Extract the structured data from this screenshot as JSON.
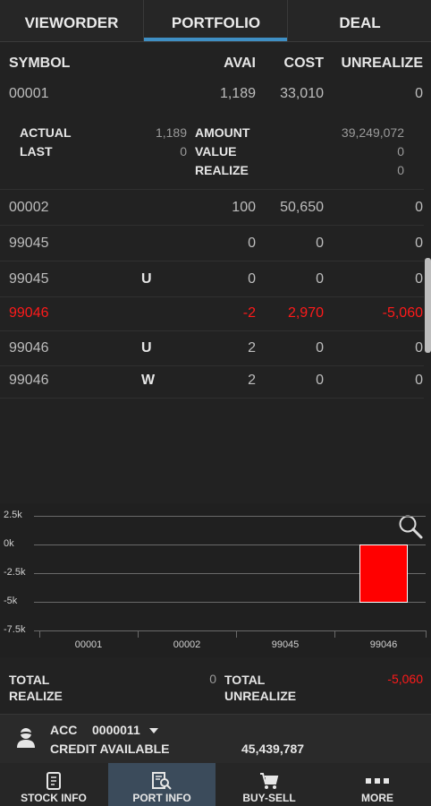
{
  "tabs": [
    {
      "label": "VIEWORDER"
    },
    {
      "label": "PORTFOLIO"
    },
    {
      "label": "DEAL"
    }
  ],
  "table": {
    "headers": {
      "symbol": "SYMBOL",
      "avai": "AVAI",
      "cost": "COST",
      "unrealize": "UNREALIZE"
    },
    "first_row": {
      "symbol": "00001",
      "flag": "",
      "avai": "1,189",
      "cost": "33,010",
      "unrealize": "0"
    },
    "detail": {
      "actual_label": "ACTUAL",
      "actual_value": "1,189",
      "last_label": "LAST",
      "last_value": "0",
      "amount_label": "AMOUNT",
      "amount_value": "39,249,072",
      "value_label": "VALUE",
      "value_value": "0",
      "realize_label": "REALIZE",
      "realize_value": "0"
    },
    "rows": [
      {
        "symbol": "00002",
        "flag": "",
        "avai": "100",
        "cost": "50,650",
        "unrealize": "0"
      },
      {
        "symbol": "99045",
        "flag": "",
        "avai": "0",
        "cost": "0",
        "unrealize": "0"
      },
      {
        "symbol": "99045",
        "flag": "U",
        "avai": "0",
        "cost": "0",
        "unrealize": "0"
      },
      {
        "symbol": "99046",
        "flag": "",
        "avai": "-2",
        "cost": "2,970",
        "unrealize": "-5,060"
      },
      {
        "symbol": "99046",
        "flag": "U",
        "avai": "2",
        "cost": "0",
        "unrealize": "0"
      },
      {
        "symbol": "99046",
        "flag": "W",
        "avai": "2",
        "cost": "0",
        "unrealize": "0"
      }
    ]
  },
  "chart_data": {
    "type": "bar",
    "categories": [
      "00001",
      "00002",
      "99045",
      "99046"
    ],
    "values": [
      0,
      0,
      0,
      -5060
    ],
    "ylim": [
      -7500,
      2500
    ],
    "yticks": [
      "2.5k",
      "0k",
      "-2.5k",
      "-5k",
      "-7.5k"
    ],
    "bar_color": "#ff0000"
  },
  "zoom_icon": "magnifier-icon",
  "totals": {
    "total_realize_line1": "TOTAL",
    "total_realize_line2": "REALIZE",
    "total_realize_value": "0",
    "total_unrealize_line1": "TOTAL",
    "total_unrealize_line2": "UNREALIZE",
    "total_unrealize_value": "-5,060"
  },
  "account": {
    "acc_label": "ACC",
    "acc_number": "0000011",
    "credit_label": "CREDIT AVAILABLE",
    "credit_value": "45,439,787"
  },
  "bottom_nav": [
    {
      "label": "STOCK INFO",
      "icon": "stock-info-icon"
    },
    {
      "label": "PORT INFO",
      "icon": "port-info-icon"
    },
    {
      "label": "BUY-SELL",
      "icon": "cart-icon"
    },
    {
      "label": "MORE",
      "icon": "more-icon"
    }
  ],
  "colors": {
    "accent": "#3f8fc4",
    "negative": "#ff1a1a"
  }
}
